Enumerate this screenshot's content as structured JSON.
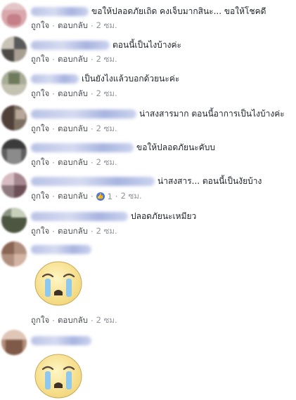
{
  "comments": [
    {
      "text": "ขอให้ปลอดภัยเถิด คงเจ็บมากสินะ... ขอให้โชคดี",
      "like": "ถูกใจ",
      "reply": "ตอบกลับ",
      "time": "2 ซม."
    },
    {
      "text": "ตอนนี้เป็นไงบ้างค่ะ",
      "like": "ถูกใจ",
      "reply": "ตอบกลับ",
      "time": "2 ซม."
    },
    {
      "text": "เป็นยังไงแล้วบอกด้วยนะค่ะ",
      "like": "ถูกใจ",
      "reply": "ตอบกลับ",
      "time": "2 ซม."
    },
    {
      "text": "น่าสงสารมาก ตอนนี้อาการเป็นไงบ้างค่ะ",
      "like": "ถูกใจ",
      "reply": "ตอบกลับ",
      "time": "2 ซม."
    },
    {
      "text": "ขอให้ปลอดภัยนะคับบ",
      "like": "ถูกใจ",
      "reply": "ตอบกลับ",
      "time": "2 ซม."
    },
    {
      "text": "น่าสงสาร... ตอนนี้เป็นงัยบ้าง",
      "like": "ถูกใจ",
      "reply": "ตอบกลับ",
      "time": "2 ซม.",
      "reactions": "1"
    },
    {
      "text": "ปลอดภัยนะเหมียว",
      "like": "ถูกใจ",
      "reply": "ตอบกลับ",
      "time": "2 ซม."
    },
    {
      "text": "",
      "like": "ถูกใจ",
      "reply": "ตอบกลับ",
      "time": "2 ซม.",
      "sticker": "crying-face-sticker"
    },
    {
      "text": "",
      "sticker": "crying-face-sticker"
    }
  ],
  "colors": {
    "link": "#4b4f56",
    "meta": "#90949c",
    "like": "#4a78d8",
    "name_blur": "#b9c2e6"
  }
}
